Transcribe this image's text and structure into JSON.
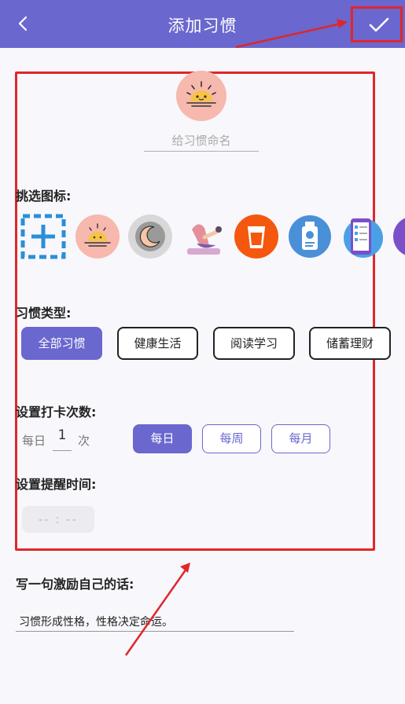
{
  "header": {
    "title": "添加习惯",
    "back_icon": "chevron-left-icon",
    "confirm_icon": "check-icon",
    "bg_color": "#6a67cf"
  },
  "name_field": {
    "placeholder": "给习惯命名",
    "value": ""
  },
  "icon_picker": {
    "label": "挑选图标:",
    "icons": [
      "add-custom-icon",
      "sunrise-icon",
      "moon-icon",
      "yoga-icon",
      "water-cup-icon",
      "medicine-bottle-icon",
      "phone-checklist-icon",
      "partial-icon"
    ]
  },
  "habit_type": {
    "label": "习惯类型:",
    "options": [
      "全部习惯",
      "健康生活",
      "阅读学习",
      "储蓄理财"
    ],
    "selected": "全部习惯"
  },
  "checkin": {
    "label": "设置打卡次数:",
    "prefix": "每日",
    "count": "1",
    "suffix": "次",
    "periods": [
      "每日",
      "每周",
      "每月"
    ],
    "selected_period": "每日"
  },
  "reminder": {
    "label": "设置提醒时间:",
    "time": "-- : --"
  },
  "motto": {
    "label": "写一句激励自己的话:",
    "value": "习惯形成性格，性格决定命运。"
  },
  "colors": {
    "accent": "#6a67cf",
    "annotation_red": "#e0262b"
  }
}
